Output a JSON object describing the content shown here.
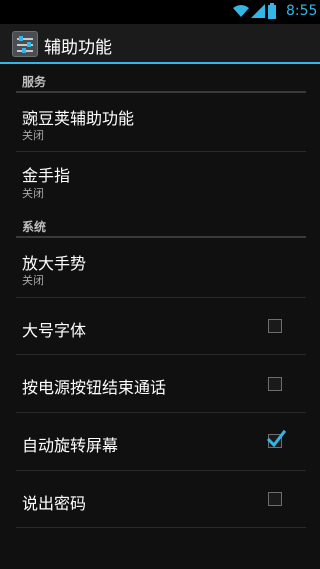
{
  "status_bar": {
    "time": "8:55",
    "icons": [
      "wifi-icon",
      "signal-icon",
      "battery-icon"
    ],
    "accent_color": "#33b5e5"
  },
  "action_bar": {
    "title": "辅助功能",
    "icon": "accessibility-settings-icon"
  },
  "categories": {
    "services": "服务",
    "system": "系统"
  },
  "services": [
    {
      "title": "豌豆荚辅助功能",
      "summary": "关闭"
    },
    {
      "title": "金手指",
      "summary": "关闭"
    }
  ],
  "system": {
    "magnification": {
      "title": "放大手势",
      "summary": "关闭"
    },
    "checkbox_prefs": [
      {
        "title": "大号字体",
        "checked": false
      },
      {
        "title": "按电源按钮结束通话",
        "checked": false
      },
      {
        "title": "自动旋转屏幕",
        "checked": true
      },
      {
        "title": "说出密码",
        "checked": false
      }
    ]
  }
}
